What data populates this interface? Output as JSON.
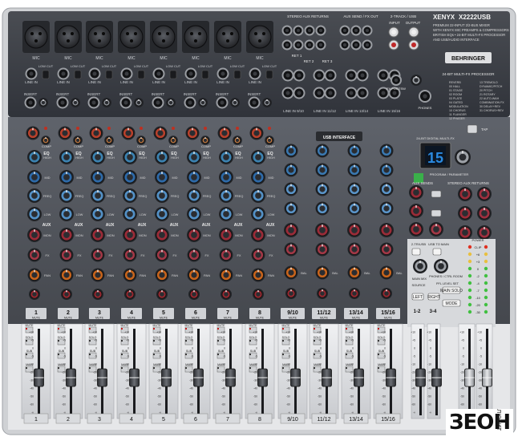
{
  "model": "XENYX X2222USB",
  "model_short": "XENYX",
  "model_num": "X2222USB",
  "brand": "BEHRINGER",
  "tagline": [
    "PREMIUM 22-INPUT 2/2-BUS MIXER",
    "WITH XENYX MIC PREAMPS & COMPRESSORS",
    "BRITISH EQs • 24-BIT MULTI-FX PROCESSOR",
    "AND USB/AUDIO INTERFACE"
  ],
  "sections": {
    "stereo_aux_returns": "STEREO AUX RETURNS",
    "aux_send_fx_out": "AUX SEND / FX OUT",
    "two_track_usb": "2-TRACK / USB",
    "input": "INPUT",
    "output": "OUTPUT",
    "fx_processor": "24-BIT MULTI-FX PROCESSOR",
    "usb_interface": "USB INTERFACE",
    "fx_display_title": "24-BIT DIGITAL MULTI-FX",
    "aux_sends": "AUX SENDS",
    "stereo_aux_returns_short": "STEREO AUX RETURNS",
    "ret": [
      "RET 1",
      "RET 2",
      "RET 3"
    ],
    "fx_footsw": "FX FOOTSW",
    "phones": "PHONES",
    "power": "POWER",
    "main_mix": "MAIN MIX",
    "main_solo": "MAIN SOLO",
    "source": "SOURCE",
    "mode": "MODE",
    "phones_ctrl_room": "PHONES / CTRL ROOM",
    "ppl_level_set": "PFL LEVEL SET",
    "usb_to_main": "USB TO MAIN",
    "to_ctrl": "2-TR/USB"
  },
  "fx": {
    "preset": "15",
    "list": [
      "REVERB",
      "00 HALL",
      "01 STAGE",
      "02 ROOM",
      "03 PLATE",
      "04 GATED",
      "MODULATION",
      "10 CHORUS",
      "11 FLANGER",
      "12 PHASER",
      "13 TREMOLO",
      "DYNAMIC/PITCH",
      "20 PITCH",
      "21 ROTARY",
      "22 AUTO-WAH",
      "COMBINATION FX",
      "30 DELAY+REV",
      "31 CHORUS+REV"
    ],
    "program_label": "PROGRAM / PARAMETER",
    "tap_label": "TAP"
  },
  "mono_channels": {
    "mic_label": "MIC",
    "line_in_label": "LINE IN",
    "low_cut_label": "LOW CUT",
    "insert_label": "INSERT",
    "comp_label": "COMP",
    "eq_label": "EQ",
    "eq_bands": [
      "HIGH",
      "MID",
      "FREQ",
      "LOW"
    ],
    "aux_label": "AUX",
    "aux_sends": [
      "MON",
      "FX"
    ],
    "pan_label": "PAN",
    "mute_label": "MUTE",
    "solo_label": "SOLO",
    "sub_label": "SUB",
    "main_label": "MAIN",
    "numbers": [
      "1",
      "2",
      "3",
      "4",
      "5",
      "6",
      "7",
      "8"
    ]
  },
  "stereo_channels": {
    "line_in_labels": [
      "LINE IN 9/10",
      "LINE IN 11/12",
      "LINE IN 13/14",
      "LINE IN 15/16"
    ],
    "level_label": "LEVEL",
    "bal_label": "BAL",
    "numbers": [
      "9/10",
      "11/12",
      "13/14",
      "15/16"
    ]
  },
  "subgroups": [
    "1-2",
    "3-4"
  ],
  "master_buttons": [
    "LEFT",
    "RIGHT"
  ],
  "meter": {
    "labels": [
      "CLIP",
      "+6",
      "+3",
      "0",
      "-2",
      "-4",
      "-7",
      "-10",
      "-20",
      "-30"
    ],
    "clip_color": "#e03020",
    "mid_color": "#e8c040",
    "low_color": "#40c040"
  },
  "fader_scale": [
    "+10",
    "+5",
    "0",
    "-5",
    "-10",
    "-20",
    "-30",
    "-40",
    "-50",
    "-60",
    "∞"
  ],
  "watermark": {
    "main": "ЗЕОН",
    "sub": "ЛЮБИТ",
    "tail": "ЗЕОН"
  },
  "colors": {
    "top_panel": "#3a3d42",
    "body": "#545860",
    "frame": "#d8d9db",
    "knob_gain": "#b8412c",
    "knob_eq_high": "#3c82b0",
    "knob_eq_mid": "#2e6aa8",
    "knob_eq_low": "#5390c5",
    "knob_aux_mon": "#9a2c38",
    "knob_aux_fx": "#a23846",
    "knob_pan": "#c7641c",
    "knob_level": "#9aa0a8",
    "display_blue": "#2a8ae0",
    "fader_strip": "#dfe1e4"
  }
}
